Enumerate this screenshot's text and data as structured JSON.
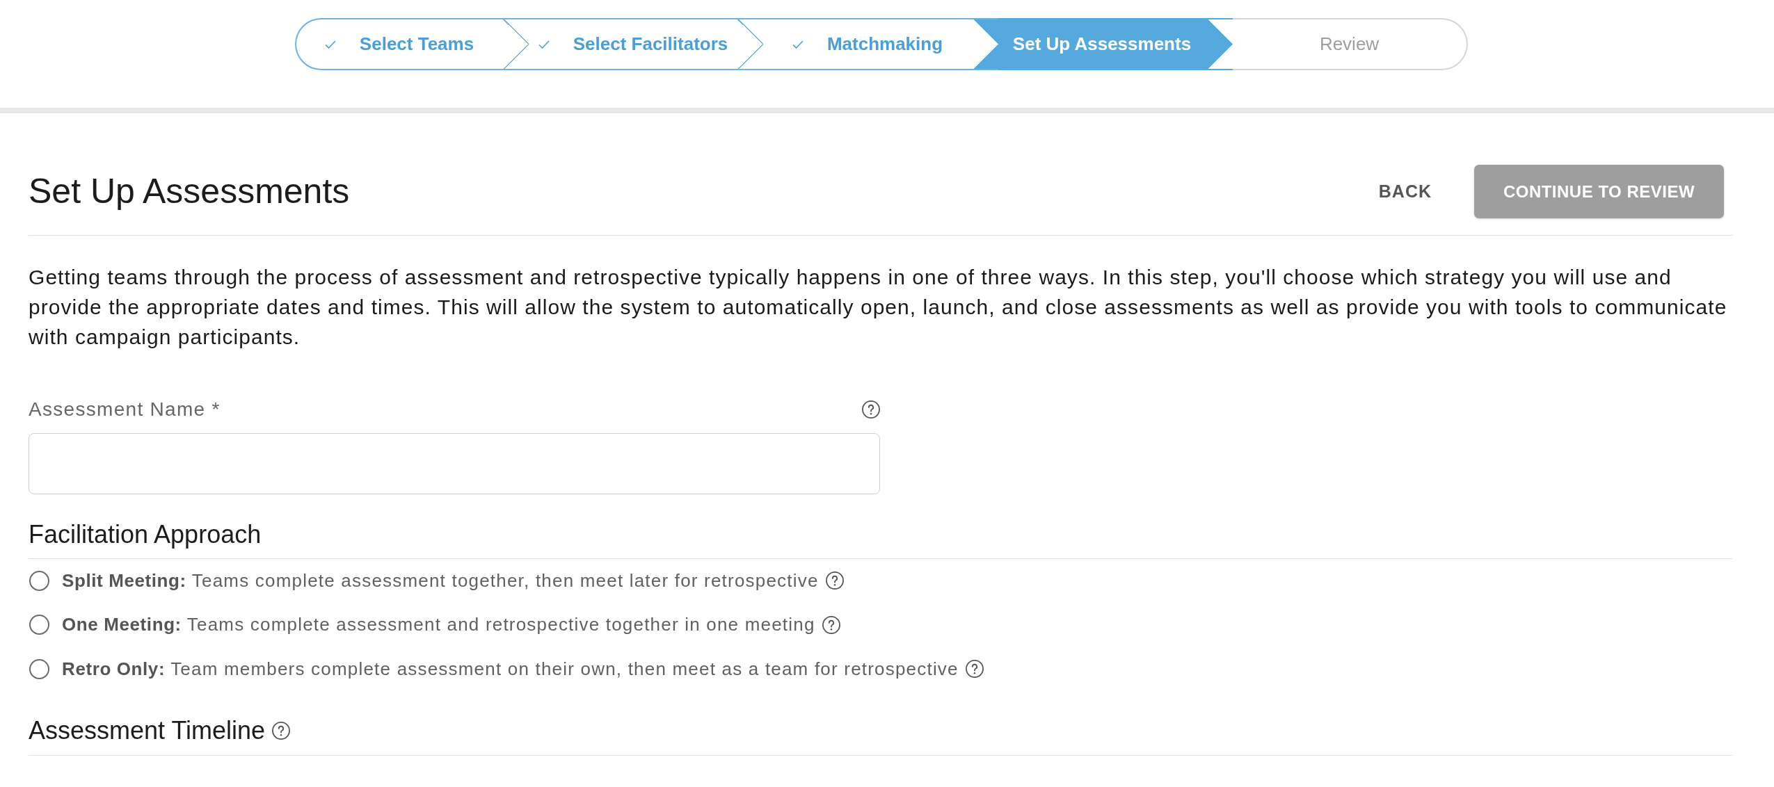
{
  "stepper": {
    "steps": [
      {
        "label": "Select Teams",
        "completed": true,
        "selected": false
      },
      {
        "label": "Select Facilitators",
        "completed": true,
        "selected": false
      },
      {
        "label": "Matchmaking",
        "completed": true,
        "selected": false
      },
      {
        "label": "Set Up Assessments",
        "completed": false,
        "selected": true
      },
      {
        "label": "Review",
        "completed": false,
        "selected": false
      }
    ]
  },
  "header": {
    "title": "Set Up Assessments",
    "buttons": [
      {
        "label": "BACK",
        "kind": "text",
        "disabled": false
      },
      {
        "label": "CONTINUE TO REVIEW",
        "kind": "filled",
        "disabled": true
      }
    ]
  },
  "intro": "Getting teams through the process of assessment and retrospective typically happens in one of three ways. In this step, you'll choose which strategy you will use and provide the appropriate dates and times. This will allow the system to automatically open, launch, and close assessments as well as provide you with tools to communicate with campaign participants.",
  "assessment_name": {
    "label": "Assessment Name *"
  },
  "facilitation_approach": {
    "title": "Facilitation Approach",
    "options": [
      {
        "text": "**Split Meeting:** Teams complete assessment together, then meet later for retrospective",
        "selected": false
      },
      {
        "text": "**One Meeting:** Teams complete assessment and retrospective together in one meeting",
        "selected": false
      },
      {
        "text": "**Retro Only:** Team members complete assessment on their own, then meet as a team for retrospective",
        "selected": false
      }
    ]
  },
  "assessment_timeline": {
    "title": "Assessment Timeline"
  }
}
